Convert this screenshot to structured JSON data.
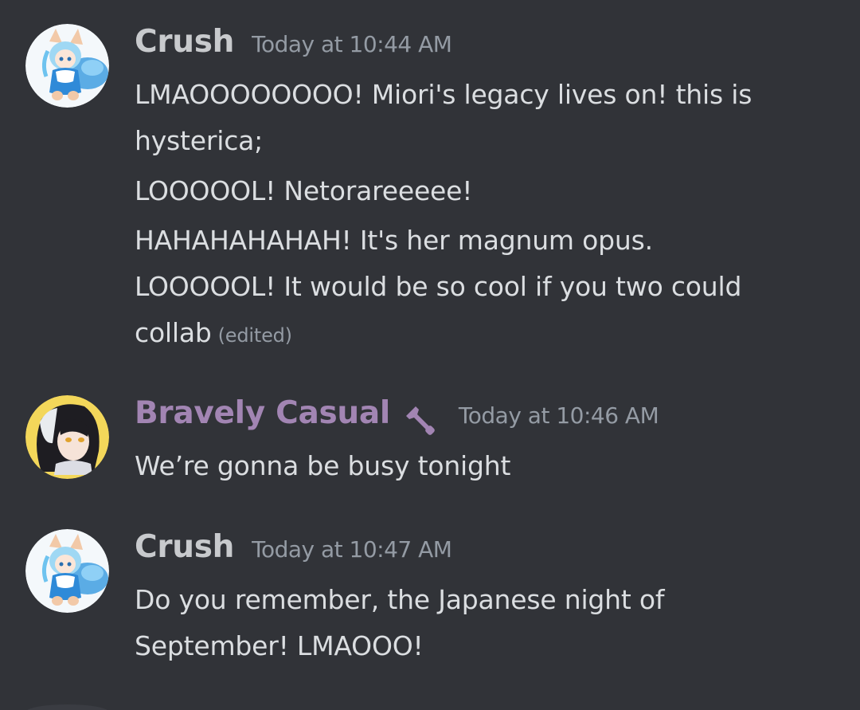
{
  "colors": {
    "background": "#313338",
    "crush_name": "#c8cacd",
    "bravely_name": "#a285b3",
    "timestamp": "#949ba4",
    "text": "#dbdee1"
  },
  "messages": [
    {
      "author": "Crush",
      "timestamp": "Today at 10:44 AM",
      "avatar_icon": "anime-fox-girl-avatar",
      "lines": [
        "LMAOOOOOOOO! Miori's legacy lives on! this is",
        "hysterica;",
        "LOOOOOL! Netorareeeee!",
        "HAHAHAHAHAH! It's her magnum opus.",
        "LOOOOOL! It would be so cool if you two could",
        "collab"
      ],
      "edited_label": "(edited)"
    },
    {
      "author": "Bravely Casual",
      "role_icon": "wrench-icon",
      "timestamp": "Today at 10:46 AM",
      "avatar_icon": "anime-dark-hair-avatar",
      "lines": [
        "We’re gonna be busy tonight"
      ]
    },
    {
      "author": "Crush",
      "timestamp": "Today at 10:47 AM",
      "avatar_icon": "anime-fox-girl-avatar",
      "lines": [
        "Do you remember, the Japanese night of",
        "September! LMAOOO!"
      ]
    }
  ]
}
